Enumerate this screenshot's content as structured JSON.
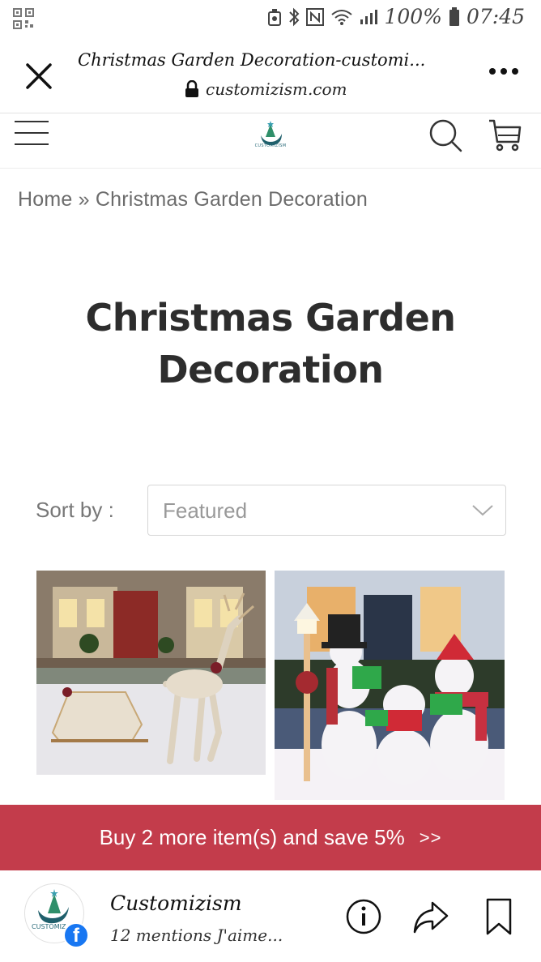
{
  "status_bar": {
    "battery": "100%",
    "time": "07:45"
  },
  "browser": {
    "tab_title": "Christmas Garden Decoration-customi...",
    "url": "customizism.com"
  },
  "header": {
    "logo_text": "CUSTOMIZISM"
  },
  "breadcrumb": "Home » Christmas Garden Decoration",
  "page": {
    "title": "Christmas Garden Decoration"
  },
  "sort": {
    "label": "Sort by :",
    "value": "Featured"
  },
  "promo": {
    "text": "Buy 2 more item(s) and save 5%",
    "arrow": ">>"
  },
  "app_bar": {
    "page_name": "Customizism",
    "likes": "12 mentions J'aime...",
    "avatar_text": "CUSTOMIZ",
    "badge": "f"
  },
  "colors": {
    "promo": "#c33c4b",
    "facebook": "#1877f2",
    "logo": "#2a6b7a"
  },
  "icons": [
    "qr-code-icon",
    "alarm-icon",
    "bluetooth-icon",
    "nfc-icon",
    "wifi-icon",
    "signal-icon",
    "battery-icon",
    "close-icon",
    "more-icon",
    "lock-icon",
    "menu-icon",
    "search-icon",
    "cart-icon",
    "chevron-down-icon",
    "info-icon",
    "share-icon",
    "bookmark-icon"
  ]
}
